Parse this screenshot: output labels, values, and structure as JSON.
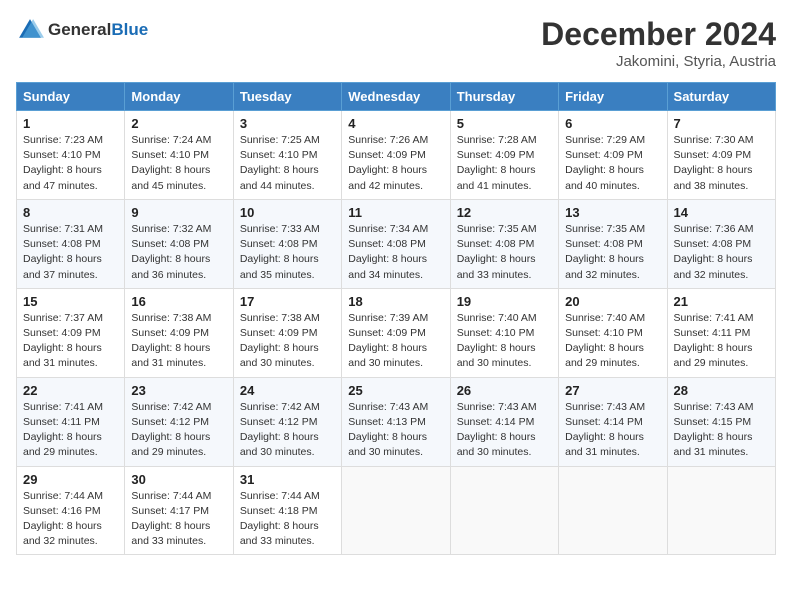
{
  "header": {
    "logo_general": "General",
    "logo_blue": "Blue",
    "month_title": "December 2024",
    "location": "Jakomini, Styria, Austria"
  },
  "columns": [
    "Sunday",
    "Monday",
    "Tuesday",
    "Wednesday",
    "Thursday",
    "Friday",
    "Saturday"
  ],
  "weeks": [
    [
      {
        "day": "1",
        "sunrise": "7:23 AM",
        "sunset": "4:10 PM",
        "daylight": "8 hours and 47 minutes."
      },
      {
        "day": "2",
        "sunrise": "7:24 AM",
        "sunset": "4:10 PM",
        "daylight": "8 hours and 45 minutes."
      },
      {
        "day": "3",
        "sunrise": "7:25 AM",
        "sunset": "4:10 PM",
        "daylight": "8 hours and 44 minutes."
      },
      {
        "day": "4",
        "sunrise": "7:26 AM",
        "sunset": "4:09 PM",
        "daylight": "8 hours and 42 minutes."
      },
      {
        "day": "5",
        "sunrise": "7:28 AM",
        "sunset": "4:09 PM",
        "daylight": "8 hours and 41 minutes."
      },
      {
        "day": "6",
        "sunrise": "7:29 AM",
        "sunset": "4:09 PM",
        "daylight": "8 hours and 40 minutes."
      },
      {
        "day": "7",
        "sunrise": "7:30 AM",
        "sunset": "4:09 PM",
        "daylight": "8 hours and 38 minutes."
      }
    ],
    [
      {
        "day": "8",
        "sunrise": "7:31 AM",
        "sunset": "4:08 PM",
        "daylight": "8 hours and 37 minutes."
      },
      {
        "day": "9",
        "sunrise": "7:32 AM",
        "sunset": "4:08 PM",
        "daylight": "8 hours and 36 minutes."
      },
      {
        "day": "10",
        "sunrise": "7:33 AM",
        "sunset": "4:08 PM",
        "daylight": "8 hours and 35 minutes."
      },
      {
        "day": "11",
        "sunrise": "7:34 AM",
        "sunset": "4:08 PM",
        "daylight": "8 hours and 34 minutes."
      },
      {
        "day": "12",
        "sunrise": "7:35 AM",
        "sunset": "4:08 PM",
        "daylight": "8 hours and 33 minutes."
      },
      {
        "day": "13",
        "sunrise": "7:35 AM",
        "sunset": "4:08 PM",
        "daylight": "8 hours and 32 minutes."
      },
      {
        "day": "14",
        "sunrise": "7:36 AM",
        "sunset": "4:08 PM",
        "daylight": "8 hours and 32 minutes."
      }
    ],
    [
      {
        "day": "15",
        "sunrise": "7:37 AM",
        "sunset": "4:09 PM",
        "daylight": "8 hours and 31 minutes."
      },
      {
        "day": "16",
        "sunrise": "7:38 AM",
        "sunset": "4:09 PM",
        "daylight": "8 hours and 31 minutes."
      },
      {
        "day": "17",
        "sunrise": "7:38 AM",
        "sunset": "4:09 PM",
        "daylight": "8 hours and 30 minutes."
      },
      {
        "day": "18",
        "sunrise": "7:39 AM",
        "sunset": "4:09 PM",
        "daylight": "8 hours and 30 minutes."
      },
      {
        "day": "19",
        "sunrise": "7:40 AM",
        "sunset": "4:10 PM",
        "daylight": "8 hours and 30 minutes."
      },
      {
        "day": "20",
        "sunrise": "7:40 AM",
        "sunset": "4:10 PM",
        "daylight": "8 hours and 29 minutes."
      },
      {
        "day": "21",
        "sunrise": "7:41 AM",
        "sunset": "4:11 PM",
        "daylight": "8 hours and 29 minutes."
      }
    ],
    [
      {
        "day": "22",
        "sunrise": "7:41 AM",
        "sunset": "4:11 PM",
        "daylight": "8 hours and 29 minutes."
      },
      {
        "day": "23",
        "sunrise": "7:42 AM",
        "sunset": "4:12 PM",
        "daylight": "8 hours and 29 minutes."
      },
      {
        "day": "24",
        "sunrise": "7:42 AM",
        "sunset": "4:12 PM",
        "daylight": "8 hours and 30 minutes."
      },
      {
        "day": "25",
        "sunrise": "7:43 AM",
        "sunset": "4:13 PM",
        "daylight": "8 hours and 30 minutes."
      },
      {
        "day": "26",
        "sunrise": "7:43 AM",
        "sunset": "4:14 PM",
        "daylight": "8 hours and 30 minutes."
      },
      {
        "day": "27",
        "sunrise": "7:43 AM",
        "sunset": "4:14 PM",
        "daylight": "8 hours and 31 minutes."
      },
      {
        "day": "28",
        "sunrise": "7:43 AM",
        "sunset": "4:15 PM",
        "daylight": "8 hours and 31 minutes."
      }
    ],
    [
      {
        "day": "29",
        "sunrise": "7:44 AM",
        "sunset": "4:16 PM",
        "daylight": "8 hours and 32 minutes."
      },
      {
        "day": "30",
        "sunrise": "7:44 AM",
        "sunset": "4:17 PM",
        "daylight": "8 hours and 33 minutes."
      },
      {
        "day": "31",
        "sunrise": "7:44 AM",
        "sunset": "4:18 PM",
        "daylight": "8 hours and 33 minutes."
      },
      null,
      null,
      null,
      null
    ]
  ]
}
